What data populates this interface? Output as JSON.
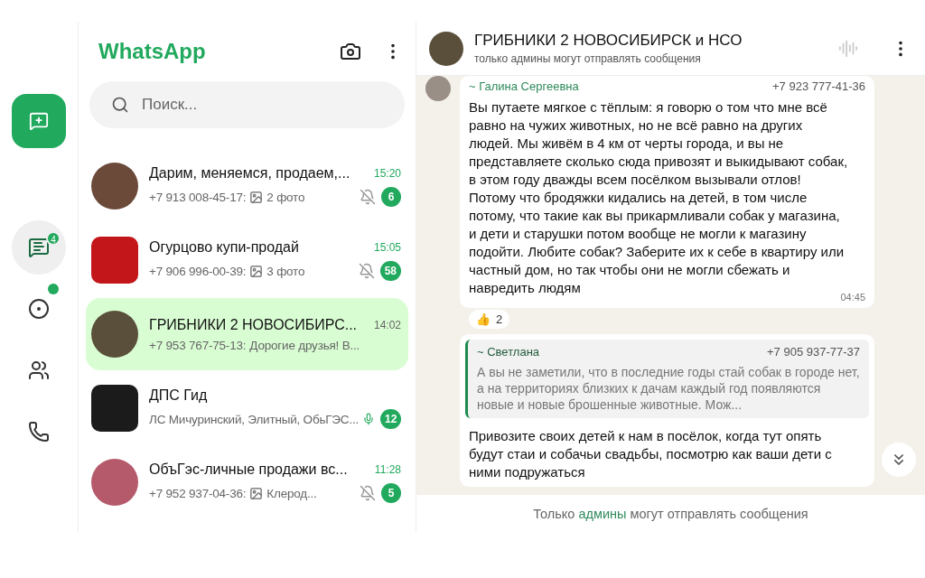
{
  "rail": {
    "new_chat": true,
    "items": [
      {
        "kind": "chats",
        "badge": "4",
        "dot": false,
        "selected": true
      },
      {
        "kind": "status",
        "dot": true,
        "selected": false
      },
      {
        "kind": "communities",
        "dot": false,
        "selected": false
      },
      {
        "kind": "calls",
        "dot": false,
        "selected": false
      }
    ]
  },
  "app_title": "WhatsApp",
  "search": {
    "placeholder": "Поиск..."
  },
  "chats": [
    {
      "name": "Дарим, меняемся, продаем,...",
      "time": "15:20",
      "sender": "+7 913 008-45-17:",
      "photo": true,
      "preview": "2 фото",
      "muted": true,
      "unread": "6",
      "selected": false,
      "kind": "round",
      "mic": false
    },
    {
      "name": "Огурцово купи-продай",
      "time": "15:05",
      "sender": "+7 906 996-00-39:",
      "photo": true,
      "preview": "3 фото",
      "muted": true,
      "unread": "58",
      "selected": false,
      "kind": "square",
      "mic": false
    },
    {
      "name": "ГРИБНИКИ 2 НОВОСИБИРС...",
      "time": "14:02",
      "sender": "+7 953 767-75-13:",
      "photo": false,
      "preview": "Дорогие друзья! В...",
      "muted": false,
      "selected": true,
      "kind": "round",
      "mic": false
    },
    {
      "name": "ДПС Гид",
      "photo": false,
      "preview": "ЛС Мичуринский, Элитный, ОбьГЭС...",
      "muted": false,
      "unread": "12",
      "selected": false,
      "kind": "square",
      "mic": true
    },
    {
      "name": "ОбъГэс-личные продажи вс...",
      "time": "11:28",
      "sender": "+7 952 937-04-36:",
      "photo": true,
      "preview": "Клерод...",
      "muted": true,
      "unread": "5",
      "selected": false,
      "kind": "round",
      "mic": false
    }
  ],
  "chat": {
    "title": "ГРИБНИКИ 2 НОВОСИБИРСК и НСО",
    "subtitle": "только админы могут отправлять сообщения",
    "messages": [
      {
        "sender": "~ Галина Сергеевна",
        "phone": "+7 923 777-41-36",
        "text": "Вы путаете мягкое с тёплым: я говорю о том что мне всё равно на чужих животных, но не всё равно на других людей. Мы живём в 4 км от черты города, и вы не представляете сколько сюда привозят и выкидывают собак, в этом году дважды всем посёлком вызывали отлов! Потому что бродяжки кидались на детей, в том числе потому, что такие как вы прикармливали собак у магазина, и дети и старушки потом вообще не могли к магазину подойти. Любите собак? Заберите их к себе в квартиру или частный дом, но так чтобы они не могли сбежать и навредить людям",
        "time": "04:45",
        "reaction": {
          "emoji": "👍",
          "count": "2"
        }
      },
      {
        "quote": {
          "sender": "~ Светлана",
          "phone": "+7 905 937-77-37",
          "text": "А вы не заметили, что в последние годы стай собак в городе нет, а на территориях близких к дачам каждый год появляются новые и  новые брошенные животные. Мож..."
        },
        "text": "Привозите своих детей к нам в посёлок, когда тут опять будут стаи и собачьи свадьбы, посмотрю как ваши дети с ними подружаться"
      }
    ],
    "footer": "Только **админы** могут отправлять сообщения"
  }
}
